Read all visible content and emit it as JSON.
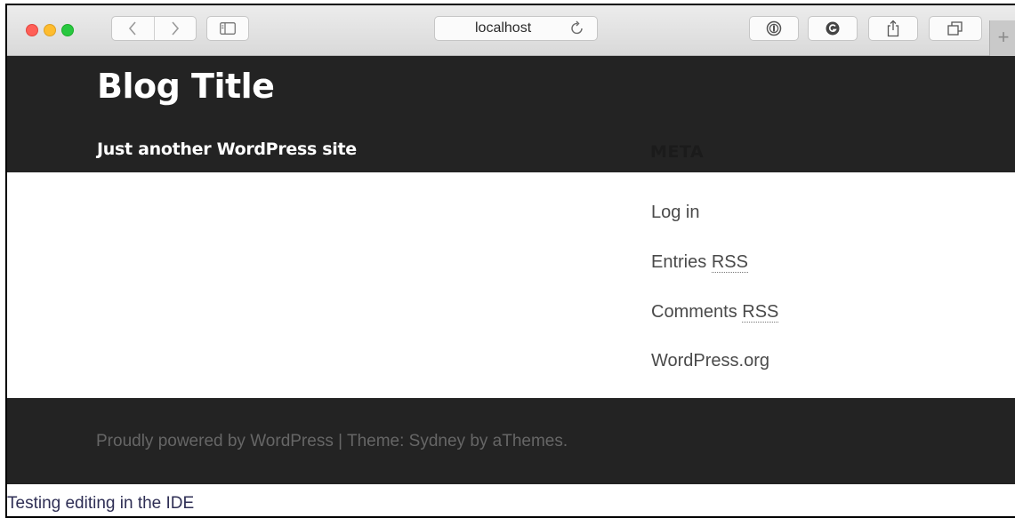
{
  "browser": {
    "address": "localhost",
    "reload_icon": "↻",
    "back_icon": "‹",
    "forward_icon": "›",
    "new_tab_label": "+"
  },
  "site": {
    "title": "Blog Title",
    "tagline": "Just another WordPress site"
  },
  "widget": {
    "title": "META",
    "items": [
      {
        "text": "Log in"
      },
      {
        "text": "Entries",
        "abbr": "RSS"
      },
      {
        "text": "Comments",
        "abbr": "RSS"
      },
      {
        "text": "WordPress.org"
      }
    ]
  },
  "footer": {
    "text": "Proudly powered by WordPress | Theme: Sydney by aThemes."
  },
  "after": {
    "text": "Testing editing in the IDE"
  },
  "colors": {
    "header_bg": "#232323",
    "footer_bg": "#232323"
  }
}
